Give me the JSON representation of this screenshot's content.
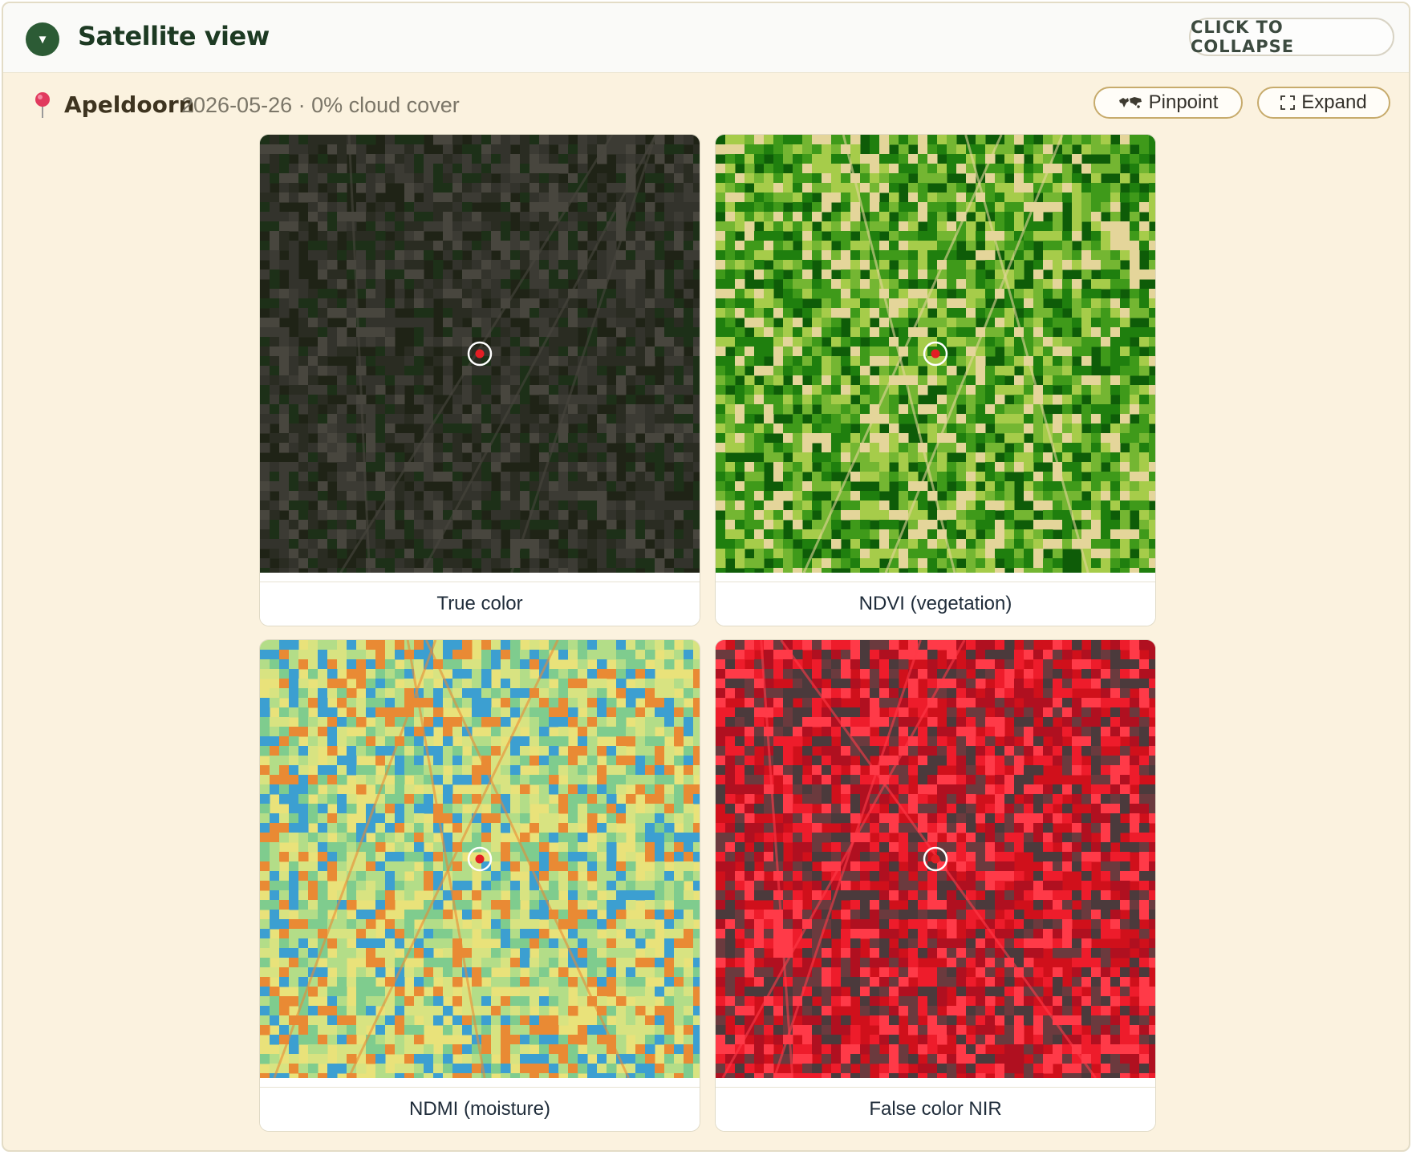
{
  "header": {
    "title": "Satellite view",
    "collapse_label": "CLICK TO COLLAPSE"
  },
  "location": {
    "name": "Apeldoorn",
    "meta": "2026-05-26 · 0% cloud cover",
    "pinpoint_label": "Pinpoint",
    "expand_label": "Expand"
  },
  "images": [
    {
      "caption": "True color",
      "palette": [
        "#1f2316",
        "#2a2c22",
        "#33332c",
        "#3c3b34",
        "#1d3018",
        "#48463e"
      ]
    },
    {
      "caption": "NDVI (vegetation)",
      "palette": [
        "#0e5c08",
        "#1f7f0e",
        "#3f9a1a",
        "#74b632",
        "#a6cc4a",
        "#e4d59a"
      ]
    },
    {
      "caption": "NDMI (moisture)",
      "palette": [
        "#e9e27a",
        "#d8e381",
        "#b3dd88",
        "#7fcc8e",
        "#3c9fd1",
        "#e98a34"
      ]
    },
    {
      "caption": "False color NIR",
      "palette": [
        "#d0101b",
        "#ee1c2b",
        "#b01020",
        "#6b3a3e",
        "#4b3a3c",
        "#ff3a48"
      ]
    }
  ],
  "icons": {
    "pin": "map-pin-icon",
    "pinpoint": "world-map-icon",
    "expand": "expand-corners-icon",
    "toggle": "chevron-down-icon"
  },
  "colors": {
    "accent": "#2c5b35",
    "panel_bg": "#fbf2df",
    "pill_border": "#c7ab6c"
  }
}
